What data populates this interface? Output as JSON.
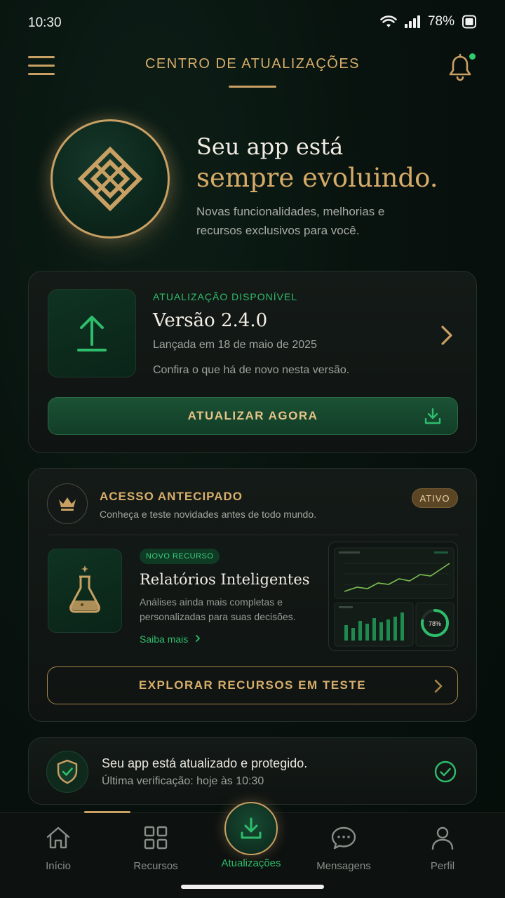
{
  "status_bar": {
    "time": "10:30",
    "battery": "78%"
  },
  "header": {
    "title": "CENTRO DE ATUALIZAÇÕES"
  },
  "hero": {
    "line1": "Seu app está",
    "line2": "sempre evoluindo.",
    "subtitle": "Novas funcionalidades, melhorias e recursos exclusivos para você."
  },
  "update_card": {
    "tag": "ATUALIZAÇÃO DISPONÍVEL",
    "version": "Versão 2.4.0",
    "release_date": "Lançada em 18 de maio de 2025",
    "description": "Confira o que há de novo nesta versão.",
    "button_label": "ATUALIZAR AGORA"
  },
  "early_access": {
    "title": "ACESSO ANTECIPADO",
    "subtitle": "Conheça e teste novidades antes de todo mundo.",
    "badge": "ATIVO",
    "feature": {
      "badge": "NOVO RECURSO",
      "title": "Relatórios Inteligentes",
      "description": "Análises ainda mais completas e personalizadas para suas decisões.",
      "link": "Saiba mais"
    },
    "preview": {
      "gauge_value": "78%",
      "gauge_fraction": 0.78
    },
    "button_label": "EXPLORAR RECURSOS EM TESTE"
  },
  "status_card": {
    "title": "Seu app está atualizado e protegido.",
    "subtitle": "Última verificação: hoje às 10:30"
  },
  "bottom_nav": {
    "items": [
      {
        "label": "Início",
        "icon": "home-icon"
      },
      {
        "label": "Recursos",
        "icon": "grid-icon"
      },
      {
        "label": "Atualizações",
        "icon": "download-icon"
      },
      {
        "label": "Mensagens",
        "icon": "chat-icon"
      },
      {
        "label": "Perfil",
        "icon": "user-icon"
      }
    ],
    "active_index": 2
  },
  "colors": {
    "gold": "#c9a063",
    "green": "#2ebd6b",
    "background": "#08120e"
  }
}
